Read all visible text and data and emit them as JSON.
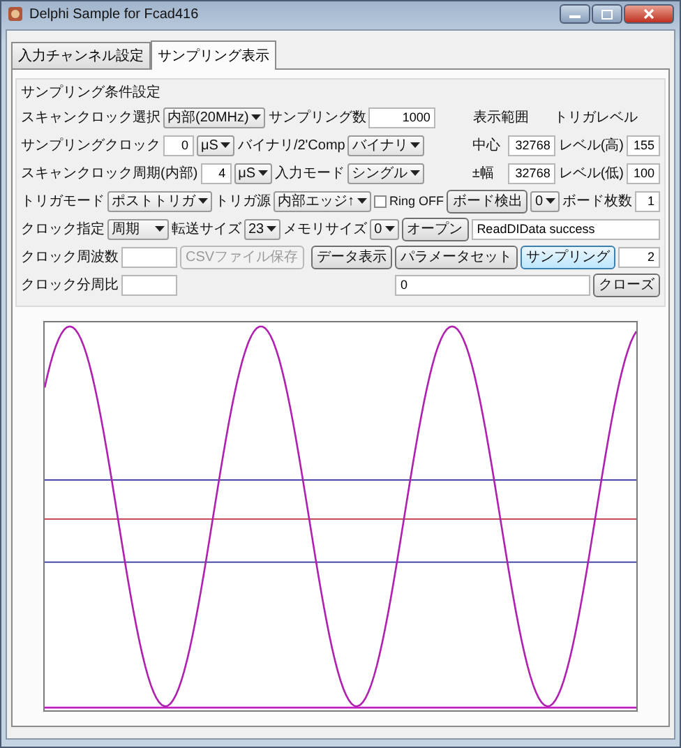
{
  "window": {
    "title": "Delphi Sample for Fcad416"
  },
  "tabs": [
    {
      "label": "入力チャンネル設定",
      "selected": false
    },
    {
      "label": "サンプリング表示",
      "selected": true
    }
  ],
  "settings": {
    "title": "サンプリング条件設定",
    "rows": [
      [
        {
          "kind": "label",
          "text": "スキャンクロック選択"
        },
        {
          "kind": "select",
          "value": "内部(20MHz)"
        },
        {
          "kind": "label",
          "text": "サンプリング数"
        },
        {
          "kind": "input",
          "value": "1000"
        }
      ],
      [
        {
          "kind": "label",
          "text": "サンプリングクロック"
        },
        {
          "kind": "input",
          "value": "0"
        },
        {
          "kind": "select",
          "value": "μS"
        },
        {
          "kind": "label",
          "text": "バイナリ/2'Comp"
        },
        {
          "kind": "select",
          "value": "バイナリ"
        }
      ],
      [
        {
          "kind": "label",
          "text": "スキャンクロック周期(内部)"
        },
        {
          "kind": "input",
          "value": "4"
        },
        {
          "kind": "select",
          "value": "μS"
        },
        {
          "kind": "label",
          "text": "入力モード"
        },
        {
          "kind": "select",
          "value": "シングル"
        }
      ],
      [
        {
          "kind": "label",
          "text": "トリガモード"
        },
        {
          "kind": "select",
          "value": "ポストトリガ"
        },
        {
          "kind": "label",
          "text": "トリガ源"
        },
        {
          "kind": "select",
          "value": "内部エッジ↑"
        },
        {
          "kind": "checkbox",
          "text": "Ring OFF",
          "checked": false
        }
      ],
      [
        {
          "kind": "label",
          "text": "クロック指定"
        },
        {
          "kind": "select",
          "value": "周期"
        },
        {
          "kind": "label",
          "text": "転送サイズ"
        },
        {
          "kind": "select",
          "value": "23"
        },
        {
          "kind": "label",
          "text": "メモリサイズ"
        },
        {
          "kind": "select",
          "value": "0"
        }
      ],
      [
        {
          "kind": "label",
          "text": "クロック周波数"
        },
        {
          "kind": "input"
        },
        {
          "kind": "button",
          "text": "CSVファイル保存",
          "disabled": true,
          "focused": false
        }
      ],
      [
        {
          "kind": "label",
          "text": "クロック分周比"
        },
        {
          "kind": "input"
        }
      ]
    ],
    "ranges": [
      [
        {
          "kind": "header",
          "text": "表示範囲"
        },
        {
          "kind": "header",
          "text": "トリガレベル"
        }
      ],
      [
        {
          "kind": "label",
          "text": "中心"
        },
        {
          "kind": "input",
          "value": "32768"
        },
        {
          "kind": "label",
          "text": "レベル(高)"
        },
        {
          "kind": "input",
          "value": "155"
        }
      ],
      [
        {
          "kind": "label",
          "text": "±幅"
        },
        {
          "kind": "input",
          "value": "32768"
        },
        {
          "kind": "label",
          "text": "レベル(低)"
        },
        {
          "kind": "input",
          "value": "100"
        }
      ]
    ],
    "board": [
      [
        {
          "kind": "button",
          "text": "ボード検出",
          "disabled": false,
          "focused": false
        },
        {
          "kind": "select",
          "value": "0"
        },
        {
          "kind": "label",
          "text": "ボード枚数"
        },
        {
          "kind": "input",
          "value": "1"
        }
      ],
      [
        {
          "kind": "button",
          "text": "オープン",
          "disabled": false,
          "focused": false
        },
        {
          "kind": "field",
          "value": "ReadDIData success"
        }
      ]
    ],
    "actions": [
      [
        {
          "kind": "button",
          "text": "データ表示",
          "disabled": false,
          "focused": false
        },
        {
          "kind": "button",
          "text": "パラメータセット",
          "disabled": false,
          "focused": false
        },
        {
          "kind": "button",
          "text": "サンプリング",
          "disabled": false,
          "focused": true
        },
        {
          "kind": "input",
          "value": "2"
        }
      ],
      [
        {
          "kind": "field",
          "value": "0"
        },
        {
          "kind": "button",
          "text": "クローズ",
          "disabled": false,
          "focused": false
        }
      ]
    ]
  }
}
